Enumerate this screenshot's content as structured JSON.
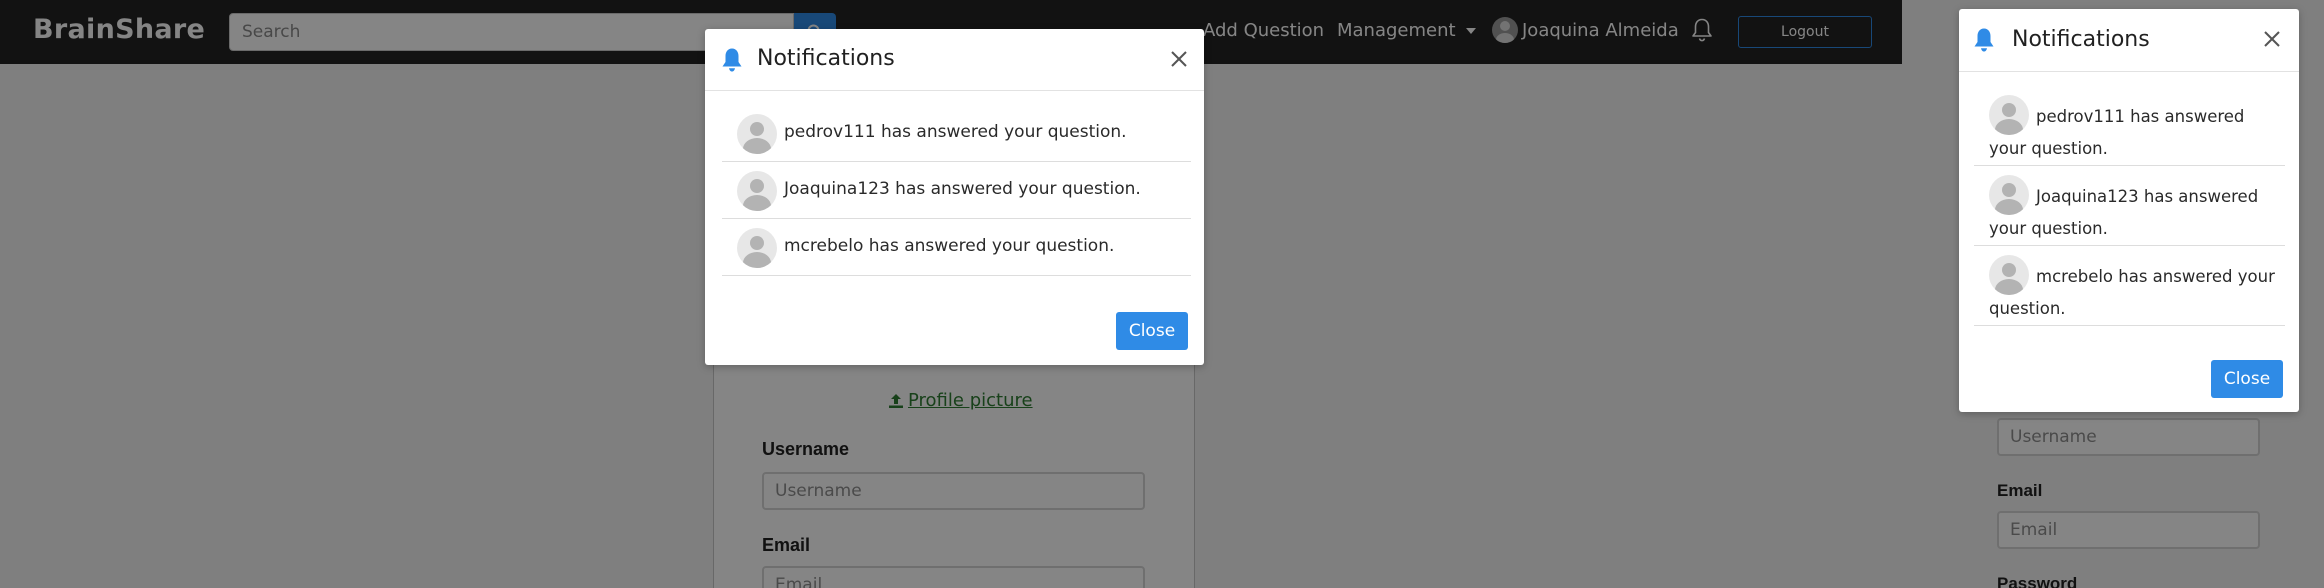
{
  "navbar": {
    "brand": "BrainShare",
    "search_placeholder": "Search",
    "add_question": "Add Question",
    "management": "Management",
    "user_name": "Joaquina Almeida",
    "logout": "Logout"
  },
  "profile": {
    "picture_link": "Profile picture",
    "username_label": "Username",
    "username_placeholder": "Username",
    "email_label": "Email",
    "email_placeholder": "Email",
    "password_label": "Password"
  },
  "notifications": {
    "title": "Notifications",
    "items": [
      {
        "text": "pedrov111 has answered your question."
      },
      {
        "text": "Joaquina123 has answered your question."
      },
      {
        "text": "mcrebelo has answered your question."
      }
    ],
    "close_button": "Close"
  },
  "colors": {
    "navbar_bg": "#232323",
    "accent_blue": "#2f8be6",
    "link_green": "#2e7d32",
    "overlay": "rgba(0,0,0,0.48)"
  },
  "icons": {
    "search": "search-icon",
    "bell": "bell-icon",
    "close": "close-icon",
    "upload": "upload-icon",
    "avatar": "avatar-icon"
  }
}
